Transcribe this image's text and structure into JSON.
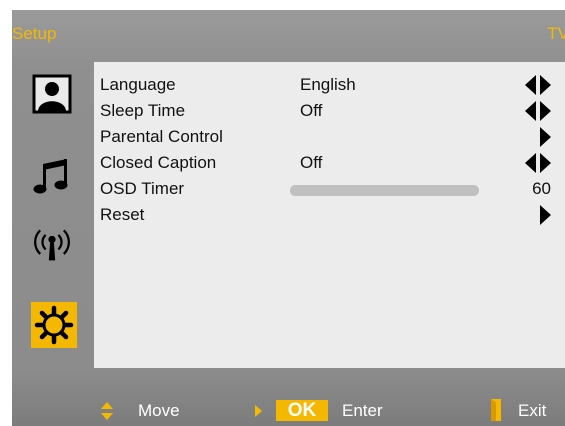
{
  "header": {
    "title": "Setup",
    "source": "TV"
  },
  "sidebar": {
    "icons": [
      {
        "name": "picture-icon",
        "selected": false
      },
      {
        "name": "music-note-icon",
        "selected": false
      },
      {
        "name": "antenna-icon",
        "selected": false
      },
      {
        "name": "gear-icon",
        "selected": true
      }
    ],
    "selected_color": "#f5b800"
  },
  "menu": {
    "items": [
      {
        "label": "Language",
        "value": "English",
        "control": "left-right"
      },
      {
        "label": "Sleep Time",
        "value": "Off",
        "control": "left-right"
      },
      {
        "label": "Parental Control",
        "value": "",
        "control": "right"
      },
      {
        "label": "Closed Caption",
        "value": "Off",
        "control": "left-right"
      },
      {
        "label": "OSD Timer",
        "value": "60",
        "control": "slider",
        "level_fraction": 1.0
      },
      {
        "label": "Reset",
        "value": "",
        "control": "right"
      }
    ]
  },
  "footer": {
    "move_label": "Move",
    "ok_label": "OK",
    "enter_label": "Enter",
    "exit_label": "Exit"
  },
  "colors": {
    "accent": "#f5b800",
    "panel": "#ececec",
    "osd_background": "#8f8f8f"
  }
}
